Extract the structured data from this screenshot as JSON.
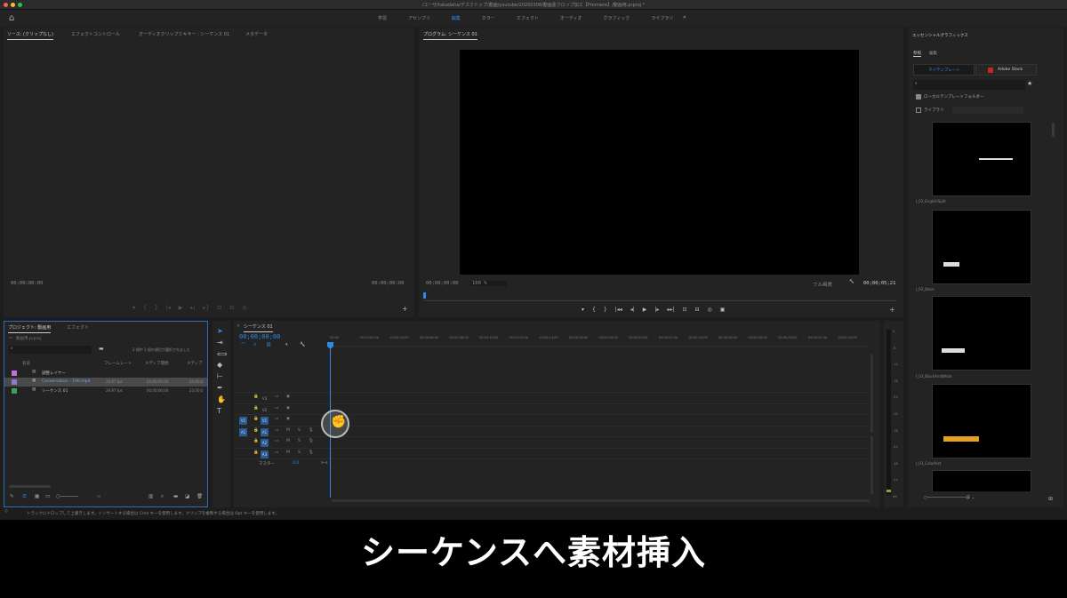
{
  "window": {
    "title": "/ユーザ/takadaha/デスクトップ/動画/youtube/20200308/動画素クロップ加工【Premiere】/動画用.prproj *"
  },
  "workspaces": {
    "tabs": [
      "学習",
      "アセンブリ",
      "編集",
      "カラー",
      "エフェクト",
      "オーディオ",
      "グラフィック",
      "ライブラリ"
    ],
    "active": "編集",
    "more": "»"
  },
  "source_panel": {
    "tabs": [
      "ソース: (クリップなし)",
      "エフェクトコントロール",
      "オーディオクリップミキサー : シーケンス 01",
      "メタデータ"
    ],
    "tc_left": "00;00;00;00",
    "tc_right": "00;00;00;00"
  },
  "program_panel": {
    "tab": "プログラム: シーケンス 01",
    "tc_left": "00;00;00;00",
    "zoom": "100 %",
    "quality": "フル画質",
    "tc_right": "00;00;05;21"
  },
  "essential_graphics": {
    "title": "エッセンシャルグラフィックス",
    "tabs": [
      "参照",
      "編集"
    ],
    "sub_tabs": [
      "マイテンプレート",
      "Adobe Stock"
    ],
    "search_placeholder": "",
    "local_folder": "ローカルテンプレートフォルダー",
    "library": "ライブラリ",
    "items": [
      "I_03_EnglishSplit",
      "I_03_Basic",
      "I_03_BlackAndWhite",
      "I_03_Colorfest"
    ]
  },
  "project_panel": {
    "tabs": [
      "プロジェクト: 動画用",
      "エフェクト"
    ],
    "file": "動画用.prproj",
    "selection_info": "2 個中 1 個の項目が選択されました",
    "columns": [
      "名前",
      "フレームレート",
      "メディア開始",
      "メディア"
    ],
    "rows": [
      {
        "name": "調整レイヤー",
        "fps": "",
        "start": "",
        "end": "",
        "color": "#c86fd6"
      },
      {
        "name": "Conversation - 100.mp4",
        "fps": "29.97 fps",
        "start": "00;00;00;00",
        "end": "00;00;0",
        "color": "#8a79d6"
      },
      {
        "name": "シーケンス 01",
        "fps": "29.97 fps",
        "start": "00;00;00;00",
        "end": "23;00;0",
        "color": "#3aa35a"
      }
    ]
  },
  "timeline": {
    "tab": "シーケンス 01",
    "timecode": "00;00;00;00",
    "ruler": [
      "00;00",
      "00;00;02;00",
      "00;00;04;00",
      "00;00;06;00",
      "00;00;08;00",
      "00;00;10;00",
      "00;00;12;00",
      "00;00;14;00",
      "00;00;16;00",
      "00;00;18;00",
      "00;00;20;00",
      "00;00;22;00",
      "00;00;24;00",
      "00;00;26;00",
      "00;00;28;00",
      "00;00;30;00",
      "00;00;32;00",
      "00;00;34;00"
    ],
    "video_tracks": [
      "V3",
      "V2",
      "V1"
    ],
    "audio_tracks": [
      "A1",
      "A2",
      "A3"
    ],
    "master": "マスター",
    "master_value": "0.0"
  },
  "meter_scale": [
    "0",
    "-6",
    "-12",
    "-18",
    "-24",
    "-30",
    "-36",
    "-42",
    "-48",
    "-54",
    "dB"
  ],
  "status_bar": "トラックにドロップして上書きします。インサートする場合は Cmd キーを使用します。クリップを複製する場合は Opt キーを使用します。",
  "caption": "シーケンスへ素材挿入"
}
